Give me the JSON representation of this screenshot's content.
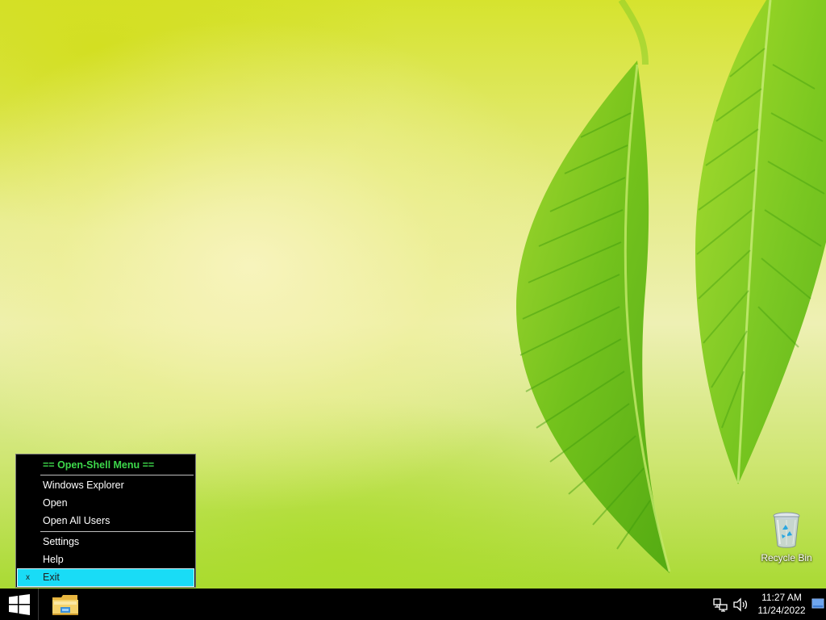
{
  "desktop": {
    "icons": [
      {
        "label": "Recycle Bin",
        "icon": "recycle-bin-icon"
      }
    ]
  },
  "context_menu": {
    "title": "== Open-Shell Menu ==",
    "items": [
      {
        "label": "Windows Explorer"
      },
      {
        "label": "Open"
      },
      {
        "label": "Open All Users"
      },
      {
        "label": "Settings"
      },
      {
        "label": "Help"
      },
      {
        "label": "Exit",
        "selected": true,
        "mark": "x"
      }
    ],
    "colors": {
      "background": "#000000",
      "title": "#3dd84b",
      "text": "#ffffff",
      "selected_background": "#19dcf6"
    }
  },
  "taskbar": {
    "start_icon": "windows-logo-icon",
    "pinned": [
      {
        "icon": "file-explorer-icon"
      }
    ],
    "tray": {
      "network_icon": "network-icon",
      "volume_icon": "volume-icon",
      "time": "11:27 AM",
      "date": "11/24/2022",
      "show_desktop_icon": "show-desktop-icon"
    }
  }
}
